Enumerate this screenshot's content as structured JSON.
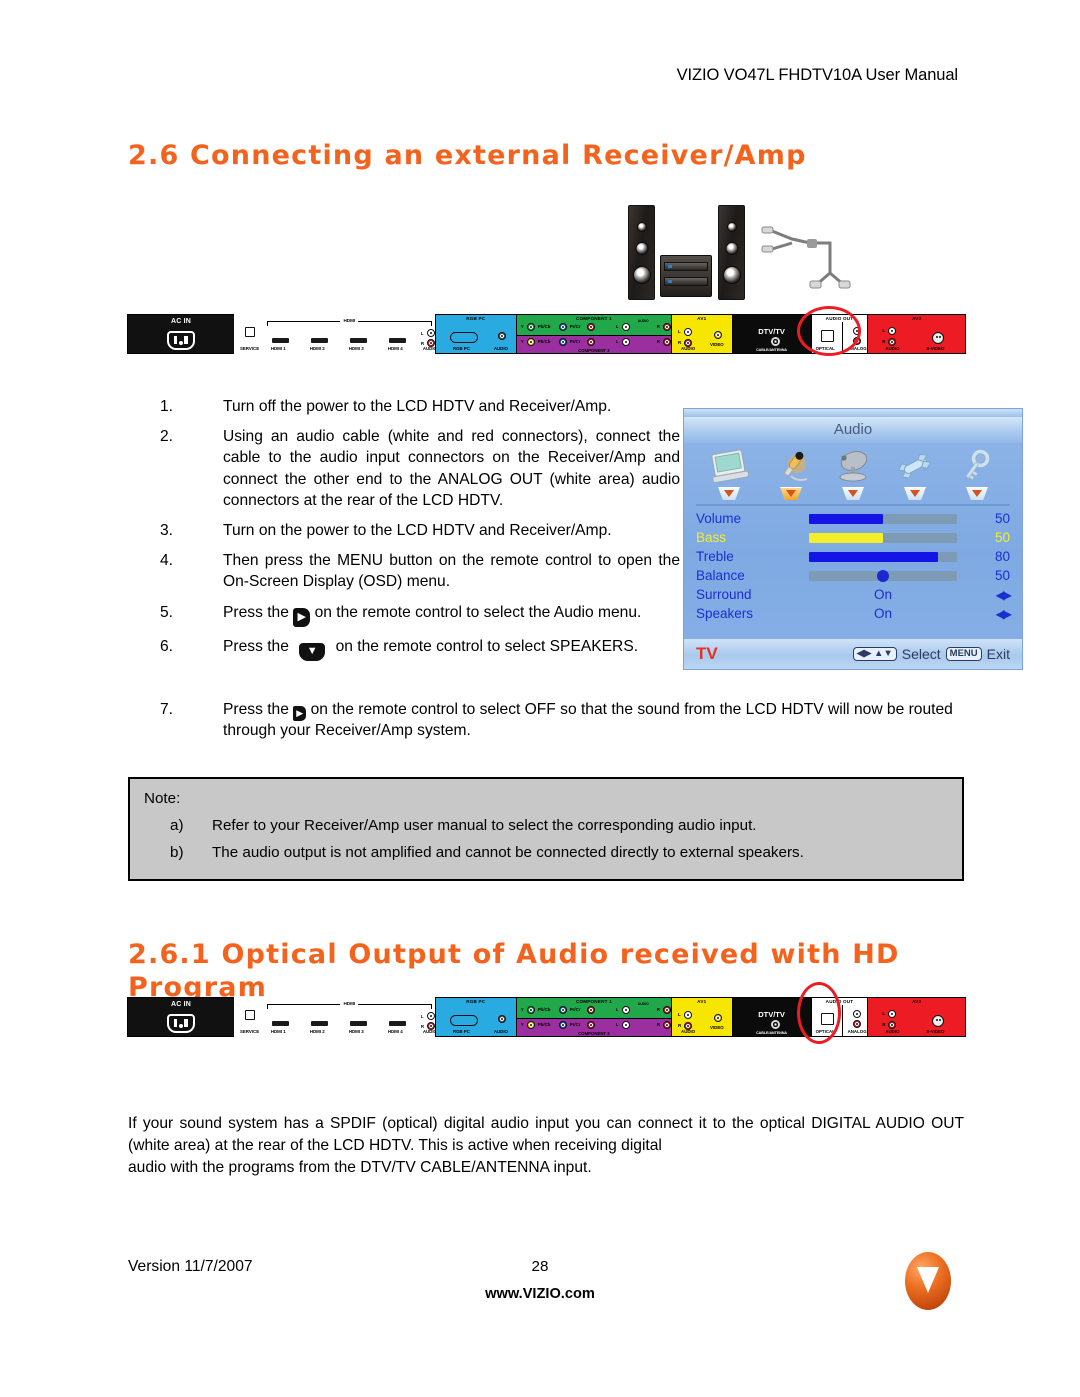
{
  "header": {
    "title": "VIZIO VO47L FHDTV10A User Manual"
  },
  "sections": {
    "s26": {
      "number": "2.6",
      "title": "Connecting an external Receiver/Amp"
    },
    "s261": {
      "number": "2.6.1",
      "title_line1": "Optical   Output   of   Audio   received   with   HD",
      "title_line2": "Program"
    }
  },
  "steps": [
    {
      "num": "1.",
      "text": "Turn off the power to the LCD HDTV and Receiver/Amp."
    },
    {
      "num": "2.",
      "text": "Using an audio cable (white and red connectors), connect the cable to the audio input connectors on the Receiver/Amp and connect the other end to the ANALOG OUT (white area) audio connectors at the rear of the LCD HDTV."
    },
    {
      "num": "3.",
      "text": "Turn on the power to the LCD HDTV and Receiver/Amp."
    },
    {
      "num": "4.",
      "text": "Then press the MENU button on the remote control to open the On-Screen Display (OSD) menu."
    }
  ],
  "step5": {
    "num": "5.",
    "pre": "Press the",
    "post": "on the remote control to select the Audio menu.",
    "glyph": "▶"
  },
  "step6": {
    "num": "6.",
    "pre": "Press the",
    "post": "on the remote control to select SPEAKERS.",
    "glyph": "▼"
  },
  "step7": {
    "num": "7.",
    "pre": "Press the",
    "post": "on the remote control to select OFF so that the sound from the LCD HDTV will now be routed through your Receiver/Amp system.",
    "glyph": "▶"
  },
  "osd": {
    "title": "Audio",
    "icons": [
      {
        "name": "picture-monitor-icon",
        "active": false
      },
      {
        "name": "audio-microphone-icon",
        "active": true
      },
      {
        "name": "tuner-satellite-icon",
        "active": false
      },
      {
        "name": "setup-wrench-icon",
        "active": false
      },
      {
        "name": "parental-key-icon",
        "active": false
      }
    ],
    "rows": [
      {
        "label": "Volume",
        "type": "bar",
        "value": "50",
        "pct": 50,
        "highlight": false
      },
      {
        "label": "Bass",
        "type": "bar",
        "value": "50",
        "pct": 50,
        "highlight": true
      },
      {
        "label": "Treble",
        "type": "bar",
        "value": "80",
        "pct": 87,
        "highlight": false
      },
      {
        "label": "Balance",
        "type": "slider",
        "value": "50",
        "pct": 50,
        "highlight": false
      },
      {
        "label": "Surround",
        "type": "onoff",
        "value": "On",
        "highlight": false
      },
      {
        "label": "Speakers",
        "type": "onoff",
        "value": "On",
        "highlight": false
      }
    ],
    "footer": {
      "source": "TV",
      "select_label": "Select",
      "menu_key": "MENU",
      "exit_label": "Exit",
      "nav_keys": "◀▶ ▲▼"
    }
  },
  "note": {
    "title": "Note:",
    "items": [
      {
        "key": "a)",
        "text": "Refer to your Receiver/Amp user manual to select the corresponding audio input."
      },
      {
        "key": "b)",
        "text": "The audio output is not amplified and cannot be connected directly to external speakers."
      }
    ]
  },
  "paragraph": {
    "body": "If your sound system has a SPDIF (optical) digital audio input you can connect it to the optical DIGITAL AUDIO OUT (white area) at the rear of the LCD HDTV.  This is active when receiving digital",
    "last": "audio with the programs from the DTV/TV CABLE/ANTENNA input."
  },
  "panel": {
    "ac_in": "AC IN",
    "service": "SERVICE",
    "hdmi_group": "HDMI",
    "hdmi_ports": [
      "HDMI 1",
      "HDMI 2",
      "HDMI 3",
      "HDMI 4"
    ],
    "hdmi_audio": "AUDIO",
    "hdmi_audio_l": "L",
    "hdmi_audio_r": "R",
    "rgb_pc_title": "RGB PC",
    "rgb_pc_port": "RGB PC",
    "rgb_pc_audio": "AUDIO",
    "component1": "COMPONENT 1",
    "component2": "COMPONENT 2",
    "comp_y": "Y",
    "comp_pb": "Pb/Cb",
    "comp_pr": "Pr/Cr",
    "comp_audio": "AUDIO",
    "comp_l": "L",
    "comp_r": "R",
    "av1_title": "AV1",
    "av1_audio": "AUDIO",
    "av1_video": "VIDEO",
    "av1_l": "L",
    "av1_r": "R",
    "dtv_title": "DTV/TV",
    "dtv_sub": "CABLE/ANTENNA",
    "audio_out_title": "AUDIO OUT",
    "optical": "OPTICAL",
    "analog": "ANALOG",
    "av2_title": "AV2",
    "av2_audio": "AUDIO",
    "av2_svideo": "S-VIDEO",
    "av2_l": "L",
    "av2_r": "R"
  },
  "footer": {
    "version": "Version 11/7/2007",
    "page": "28",
    "site": "www.VIZIO.com",
    "logo_letter": "V"
  },
  "colors": {
    "heading_orange": "#F4631E",
    "highlight_red": "#ED1C24",
    "osd_blue": "#1A2FCF",
    "osd_yellow": "#F2EF2A"
  }
}
